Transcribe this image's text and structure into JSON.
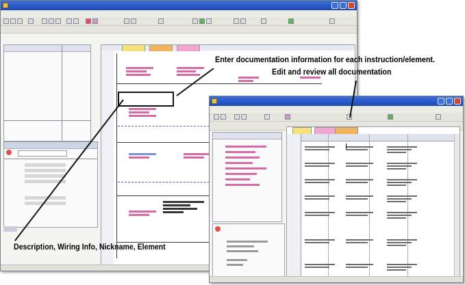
{
  "back_window": {
    "title": "",
    "menus": [
      "",
      "",
      "",
      "",
      "",
      "",
      ""
    ],
    "nav_lines": [
      "",
      "",
      "",
      "",
      "",
      "",
      "",
      "",
      ""
    ]
  },
  "front_window": {
    "title": "",
    "tabs": [
      "",
      "",
      ""
    ]
  },
  "callouts": {
    "top_line1": "Enter documentation information for each instruction/element.",
    "top_line2": "Edit and review all documentation",
    "bottom": "Description, Wiring Info, Nickname, Element"
  },
  "colors": {
    "title_bar": "#1d49b8",
    "ladder_text": "#b0127a",
    "ladder_blue_text": "#1d3fb0",
    "tab_yellow": "#f6e27a",
    "tab_pink": "#f0a6d0",
    "tab_orange": "#f3b35a"
  }
}
